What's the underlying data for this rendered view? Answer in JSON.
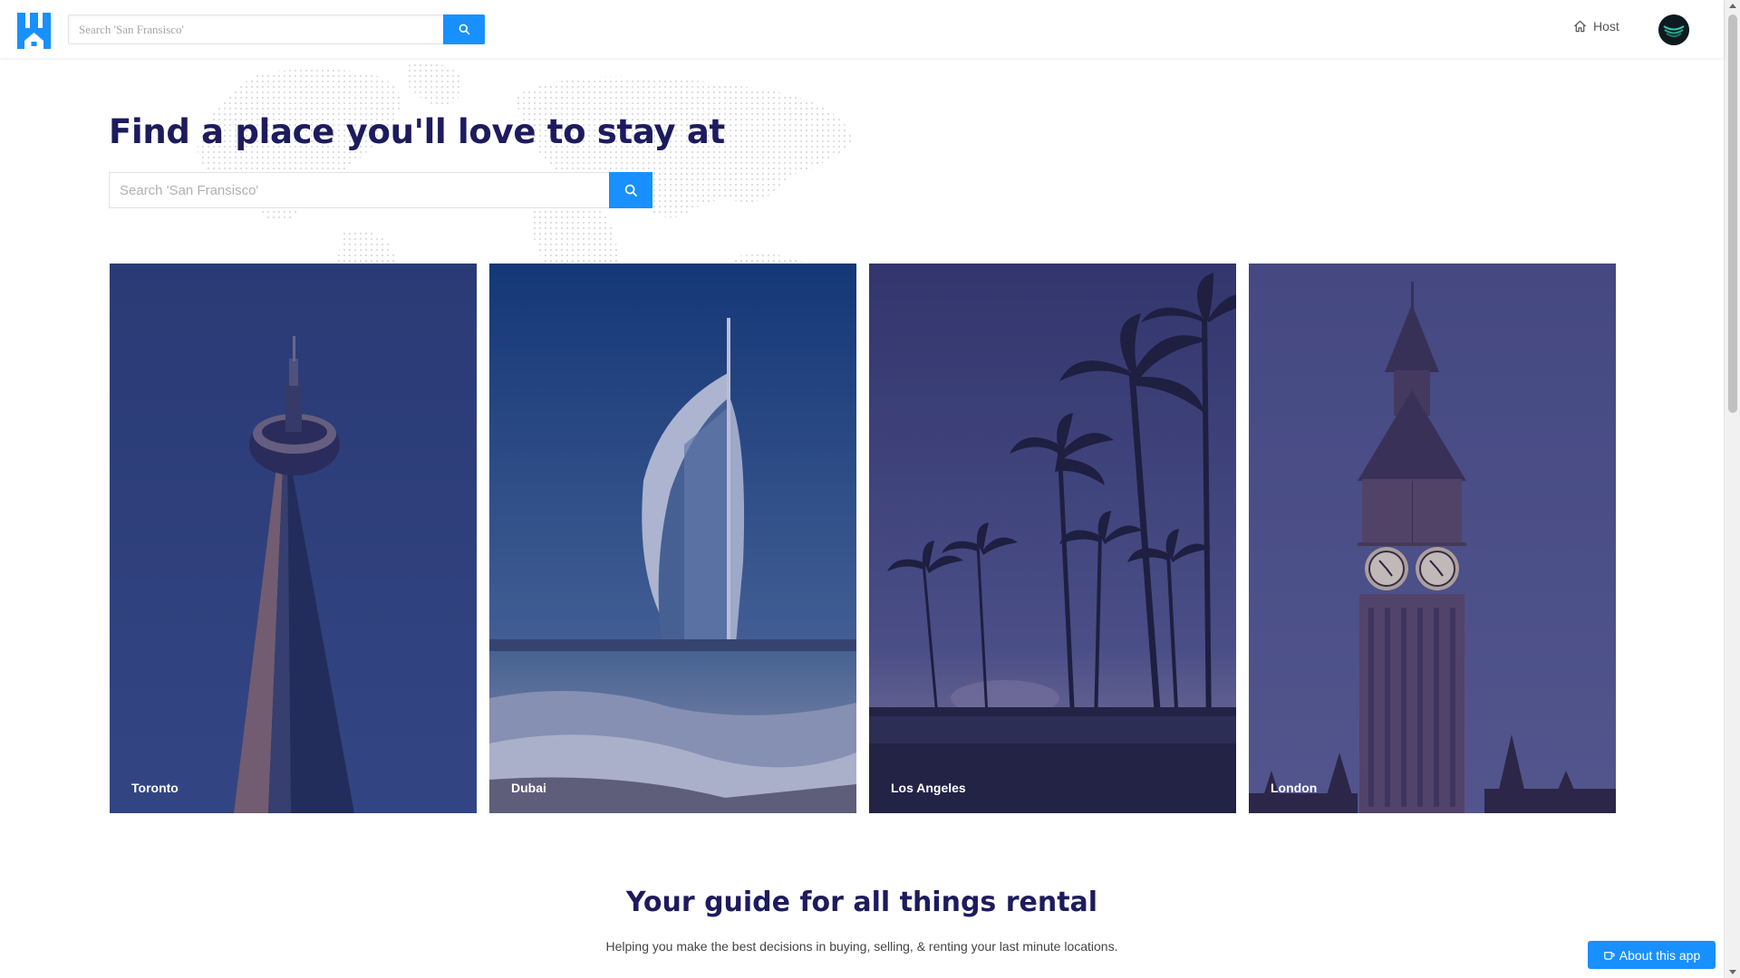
{
  "header": {
    "logo_icon": "house-h-logo-icon",
    "search_placeholder": "Search 'San Fransisco'",
    "search_icon": "search-icon",
    "host_label": "Host",
    "host_icon": "home-icon",
    "avatar_icon": "user-avatar"
  },
  "hero": {
    "title": "Find a place you'll love to stay at",
    "search_placeholder": "Search 'San Fransisco'",
    "search_icon": "search-icon"
  },
  "cities": [
    {
      "label": "Toronto"
    },
    {
      "label": "Dubai"
    },
    {
      "label": "Los Angeles"
    },
    {
      "label": "London"
    }
  ],
  "guide": {
    "title": "Your guide for all things rental",
    "subtitle": "Helping you make the best decisions in buying, selling, & renting your last minute locations."
  },
  "about_button": {
    "label": "About this app",
    "icon": "coffee-icon"
  },
  "colors": {
    "accent": "#1890ff",
    "heading": "#1d1b5e",
    "card_overlay": "#2a2f6e"
  }
}
